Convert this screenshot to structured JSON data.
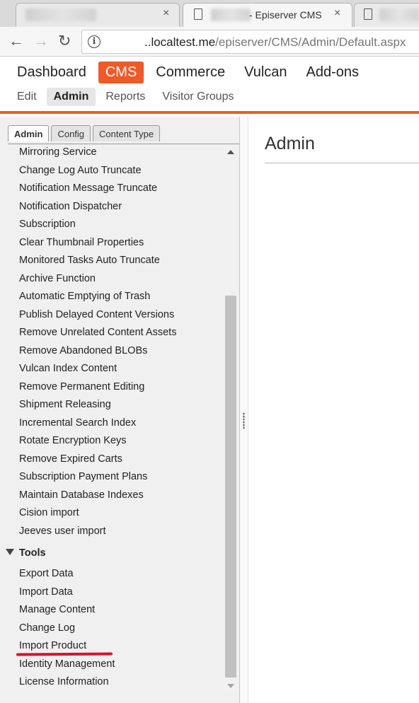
{
  "browser": {
    "active_tab_title": "- Episerver CMS",
    "tab_close": "×",
    "url_host": "..localtest.me",
    "url_path": "/episerver/CMS/Admin/Default.aspx",
    "back": "←",
    "forward": "→",
    "reload": "↻",
    "info": "i"
  },
  "main_menu": [
    "Dashboard",
    "CMS",
    "Commerce",
    "Vulcan",
    "Add-ons"
  ],
  "main_menu_active": "CMS",
  "sub_menu": [
    "Edit",
    "Admin",
    "Reports",
    "Visitor Groups"
  ],
  "sub_menu_active": "Admin",
  "panel_tabs": [
    "Admin",
    "Config",
    "Content Type"
  ],
  "panel_tab_active": "Admin",
  "scheduled_jobs": [
    "Mirroring Service",
    "Change Log Auto Truncate",
    "Notification Message Truncate",
    "Notification Dispatcher",
    "Subscription",
    "Clear Thumbnail Properties",
    "Monitored Tasks Auto Truncate",
    "Archive Function",
    "Automatic Emptying of Trash",
    "Publish Delayed Content Versions",
    "Remove Unrelated Content Assets",
    "Remove Abandoned BLOBs",
    "Vulcan Index Content",
    "Remove Permanent Editing",
    "Shipment Releasing",
    "Incremental Search Index",
    "Rotate Encryption Keys",
    "Remove Expired Carts",
    "Subscription Payment Plans",
    "Maintain Database Indexes",
    "Cision import",
    "Jeeves user import"
  ],
  "tools_section": "Tools",
  "tools": [
    "Export Data",
    "Import Data",
    "Manage Content",
    "Change Log",
    "Import Product",
    "Identity Management",
    "License Information"
  ],
  "content": {
    "heading": "Admin"
  },
  "colors": {
    "accent": "#f05a28",
    "annotation": "#e0102a"
  }
}
